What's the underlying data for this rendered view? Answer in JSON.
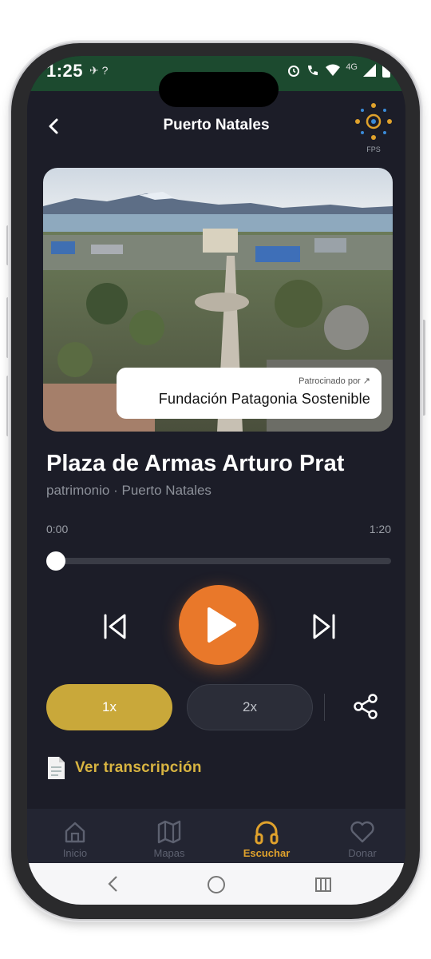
{
  "status_bar": {
    "time": "1:25",
    "left_icons": "✈ ?",
    "network": "4G"
  },
  "header": {
    "title": "Puerto Natales",
    "logo_label": "FPS"
  },
  "hero": {
    "sponsor_caption": "Patrocinado por ↗",
    "sponsor_name": "Fundación Patagonia Sostenible"
  },
  "track": {
    "title": "Plaza de Armas Arturo Prat",
    "subtitle": "patrimonio · Puerto Natales",
    "time_elapsed": "0:00",
    "time_total": "1:20",
    "progress": 0.0
  },
  "speed": {
    "option_1": "1x",
    "option_2": "2x",
    "selected": "1x"
  },
  "transcript": {
    "label": "Ver transcripción"
  },
  "bottom_nav": {
    "items": [
      {
        "label": "Inicio",
        "icon": "home-icon"
      },
      {
        "label": "Mapas",
        "icon": "map-icon"
      },
      {
        "label": "Escuchar",
        "icon": "headphones-icon",
        "active": true
      },
      {
        "label": "Donar",
        "icon": "heart-icon"
      }
    ]
  },
  "colors": {
    "background": "#1c1d28",
    "accent_orange": "#e9782a",
    "accent_gold": "#c9a83a",
    "transcript_gold": "#d8b441",
    "status_bar": "#1c4a2f"
  }
}
